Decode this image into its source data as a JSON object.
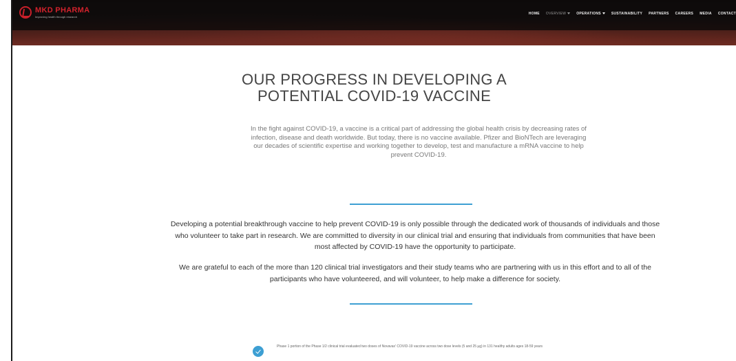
{
  "brand": {
    "name": "MKD PHARMA",
    "tagline": "Improving health through research",
    "accent_color": "#d2222c"
  },
  "nav": {
    "items": [
      {
        "label": "HOME",
        "dropdown": false,
        "active": false
      },
      {
        "label": "OVERVIEW",
        "dropdown": true,
        "active": true
      },
      {
        "label": "OPERATIONS",
        "dropdown": true,
        "active": false
      },
      {
        "label": "SUSTAINABILITY",
        "dropdown": false,
        "active": false
      },
      {
        "label": "PARTNERS",
        "dropdown": false,
        "active": false
      },
      {
        "label": "CAREERS",
        "dropdown": false,
        "active": false
      },
      {
        "label": "MEDIA",
        "dropdown": false,
        "active": false
      },
      {
        "label": "CONTACT",
        "dropdown": false,
        "active": false
      }
    ]
  },
  "main": {
    "title_line1": "OUR PROGRESS IN DEVELOPING A",
    "title_line2": "POTENTIAL COVID-19 VACCINE",
    "intro": "In the fight against COVID-19, a vaccine is a critical part of addressing the global health crisis by decreasing rates of infection, disease and death worldwide. But today, there is no vaccine available. Pfizer and BioNTech are leveraging our decades of scientific expertise and working together to develop, test and manufacture a mRNA vaccine to help prevent COVID-19.",
    "paragraph1": "Developing a potential breakthrough vaccine to help prevent COVID-19 is only possible through the dedicated work of thousands of individuals and those who volunteer to take part in research. We are committed to diversity in our clinical trial and ensuring that individuals from communities that have been most affected by COVID-19 have the opportunity to participate.",
    "paragraph2": "We are grateful to each of the more than 120 clinical trial investigators and their study teams who are partnering with us in this effort and to all of the participants who have volunteered, and will volunteer, to help make a difference for society.",
    "divider_color": "#3d9fd3",
    "trial_item": "Phase 1 portion of the Phase 1/2 clinical trial evaluated two doses of Novavax' COVID-19 vaccine across two dose levels (5 and 25 µg) in 131 healthy adults ages 18-59 years"
  },
  "icons": {
    "logo": "logo-mark-icon",
    "check": "check-circle-icon",
    "dropdown": "chevron-down-icon"
  }
}
